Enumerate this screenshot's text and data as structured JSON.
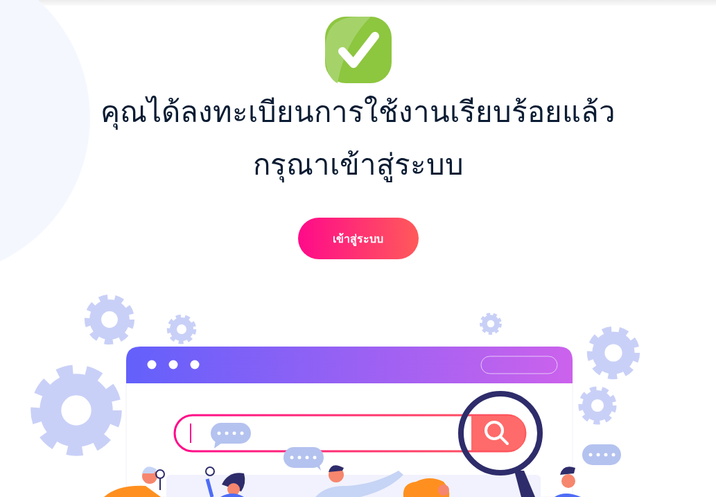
{
  "heading_lines": [
    "คุณได้ลงทะเบียนการใช้งานเรียบร้อยแล้ว",
    "กรุณาเข้าสู่ระบบ"
  ],
  "login_button": {
    "label": "เข้าสู่ระบบ"
  }
}
